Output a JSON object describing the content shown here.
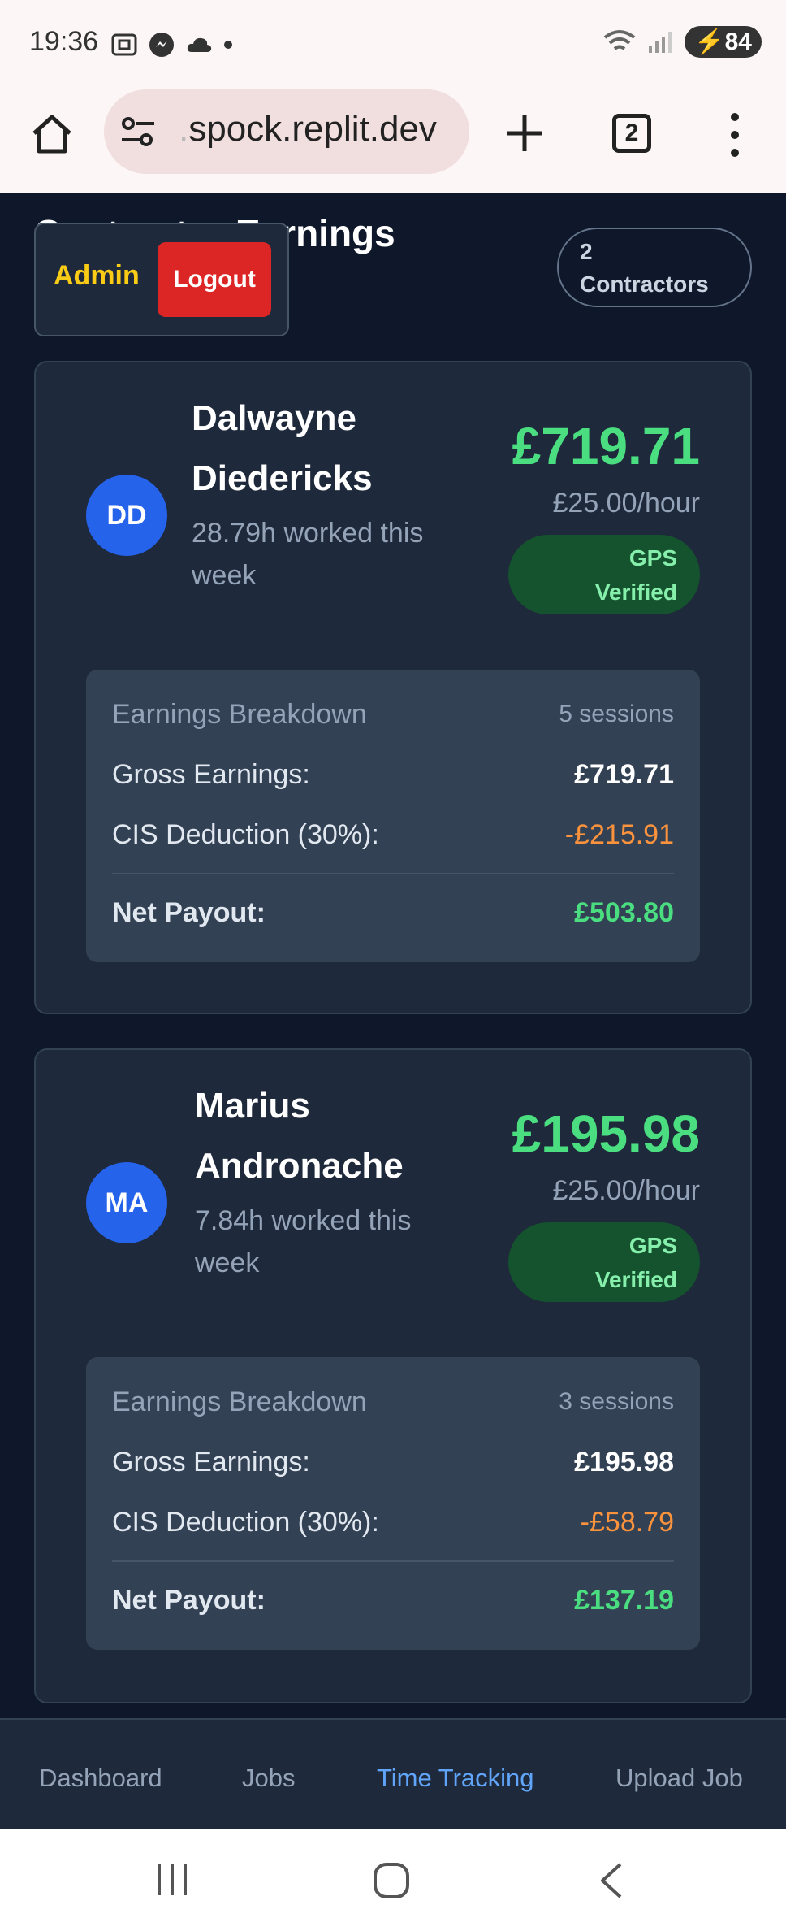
{
  "status_bar": {
    "time": "19:36",
    "battery": "84"
  },
  "browser": {
    "url_prefix": ".",
    "url": "spock.replit.dev",
    "tab_count": "2"
  },
  "header": {
    "title": "Contractor Earnings",
    "admin_label": "Admin",
    "logout_label": "Logout",
    "count_number": "2",
    "count_label": "Contractors"
  },
  "contractors": [
    {
      "initials": "DD",
      "first_name": "Dalwayne",
      "last_name": "Diedericks",
      "hours": "28.79h worked this week",
      "amount": "£719.71",
      "rate": "£25.00/hour",
      "gps_line1": "GPS",
      "gps_line2": "Verified",
      "breakdown": {
        "title": "Earnings Breakdown",
        "sessions": "5 sessions",
        "gross_label": "Gross Earnings:",
        "gross_value": "£719.71",
        "cis_label": "CIS Deduction (30%):",
        "cis_value": "-£215.91",
        "net_label": "Net Payout:",
        "net_value": "£503.80"
      }
    },
    {
      "initials": "MA",
      "first_name": "Marius",
      "last_name": "Andronache",
      "hours": "7.84h worked this week",
      "amount": "£195.98",
      "rate": "£25.00/hour",
      "gps_line1": "GPS",
      "gps_line2": "Verified",
      "breakdown": {
        "title": "Earnings Breakdown",
        "sessions": "3 sessions",
        "gross_label": "Gross Earnings:",
        "gross_value": "£195.98",
        "cis_label": "CIS Deduction (30%):",
        "cis_value": "-£58.79",
        "net_label": "Net Payout:",
        "net_value": "£137.19"
      }
    }
  ],
  "bottom_nav": {
    "dashboard": "Dashboard",
    "jobs": "Jobs",
    "time_tracking": "Time Tracking",
    "upload_job": "Upload Job",
    "active": "time_tracking"
  },
  "colors": {
    "accent_green": "#4ade80",
    "deduction_orange": "#fb923c",
    "logout_red": "#dc2626",
    "admin_yellow": "#facc15",
    "active_nav_blue": "#60a5fa"
  }
}
